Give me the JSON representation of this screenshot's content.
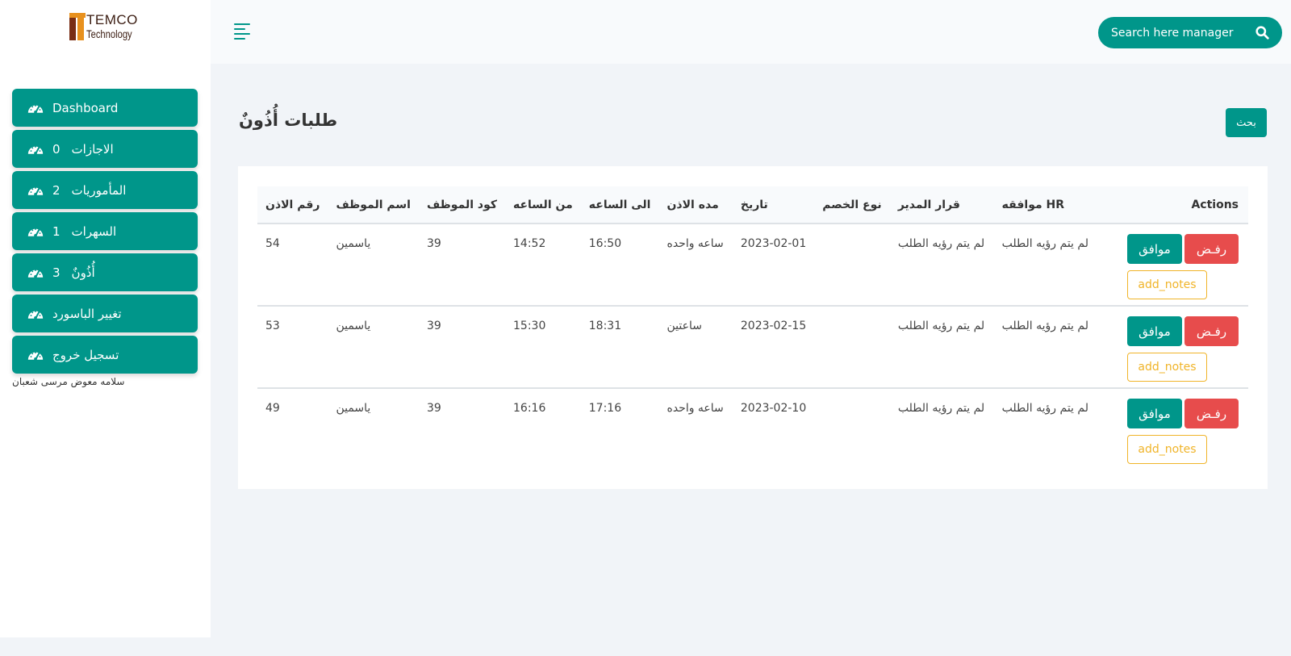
{
  "brand": {
    "line1": "TEMCO",
    "line2": "Technology"
  },
  "sidebar": {
    "items": [
      {
        "label": "Dashboard",
        "count": "",
        "icon": "gauge-icon"
      },
      {
        "label": "الاجازات",
        "count": "0",
        "icon": "gauge-icon"
      },
      {
        "label": "المأموريات",
        "count": "2",
        "icon": "gauge-icon"
      },
      {
        "label": "السهرات",
        "count": "1",
        "icon": "gauge-icon"
      },
      {
        "label": "أُذُونٌ",
        "count": "3",
        "icon": "gauge-icon"
      },
      {
        "label": "تغيير الباسورد",
        "count": "",
        "icon": "gauge-icon"
      },
      {
        "label": "تسجيل خروج",
        "count": "",
        "icon": "gauge-icon"
      }
    ],
    "user_name": "سلامه معوض مرسى شعبان"
  },
  "search": {
    "placeholder": "Search here manager"
  },
  "page": {
    "title": "طلبات أُذُونٌ",
    "search_button": "بحث"
  },
  "table": {
    "headers": {
      "perm_no": "رقم الاذن",
      "emp_name": "اسم الموظف",
      "emp_code": "كود الموظف",
      "from_hour": "من الساعه",
      "to_hour": "الى الساعه",
      "duration": "مده الاذن",
      "date": "تاريخ",
      "deduction": "نوع الخصم",
      "manager_decision": "قرار المدير",
      "hr_approval": "موافقه HR",
      "actions": "Actions"
    },
    "rows": [
      {
        "perm_no": "54",
        "emp_name": "ياسمين",
        "emp_code": "39",
        "from_hour": "14:52",
        "to_hour": "16:50",
        "duration": "ساعه واحده",
        "date": "2023-02-01",
        "deduction": "",
        "manager_decision": "لم يتم رؤيه الطلب",
        "hr_approval": "لم يتم رؤيه الطلب"
      },
      {
        "perm_no": "53",
        "emp_name": "ياسمين",
        "emp_code": "39",
        "from_hour": "15:30",
        "to_hour": "18:31",
        "duration": "ساعتين",
        "date": "2023-02-15",
        "deduction": "",
        "manager_decision": "لم يتم رؤيه الطلب",
        "hr_approval": "لم يتم رؤيه الطلب"
      },
      {
        "perm_no": "49",
        "emp_name": "ياسمين",
        "emp_code": "39",
        "from_hour": "16:16",
        "to_hour": "17:16",
        "duration": "ساعه واحده",
        "date": "2023-02-10",
        "deduction": "",
        "manager_decision": "لم يتم رؤيه الطلب",
        "hr_approval": "لم يتم رؤيه الطلب"
      }
    ],
    "actions": {
      "approve": "موافق",
      "reject": "رفـض",
      "notes": "add_notes"
    }
  },
  "colors": {
    "primary": "#00968a",
    "danger": "#e74c4c",
    "warning": "#f0b429",
    "background": "#f1f4f8"
  }
}
